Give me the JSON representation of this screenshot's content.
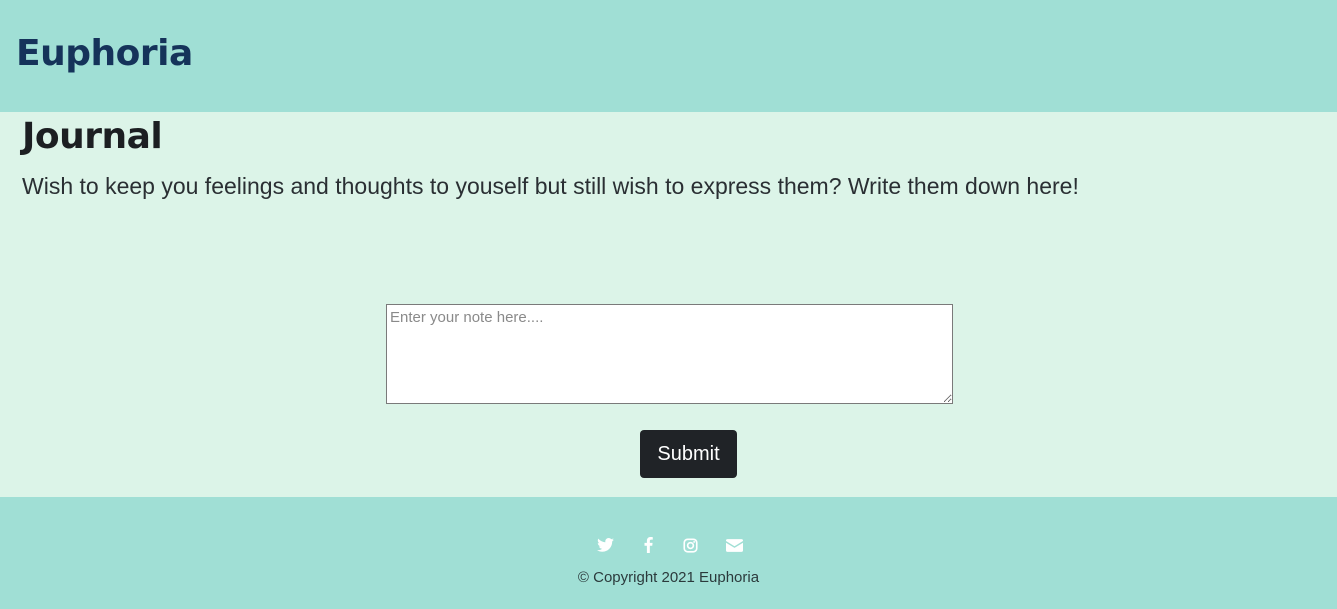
{
  "navbar": {
    "brand": "Euphoria"
  },
  "main": {
    "title": "Journal",
    "intro": "Wish to keep you feelings and thoughts to youself but still wish to express them? Write them down here!",
    "note_input": {
      "placeholder": "Enter your note here....",
      "value": ""
    },
    "submit_label": "Submit"
  },
  "footer": {
    "social_icons": [
      "twitter-icon",
      "facebook-icon",
      "instagram-icon",
      "envelope-icon"
    ],
    "copyright": "© Copyright 2021 Euphoria"
  },
  "colors": {
    "header_footer_bg": "#a0dfd5",
    "content_bg": "#dcf4e8",
    "brand_text": "#15335a",
    "button_bg": "#202327"
  }
}
